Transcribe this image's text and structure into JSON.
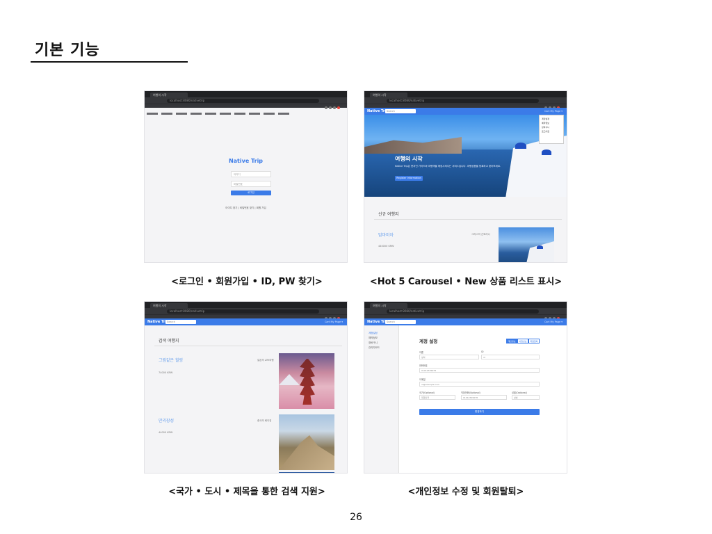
{
  "slide": {
    "title": "기본 기능",
    "page_number": "26"
  },
  "captions": {
    "login": "<로그인 • 회원가입 • ID, PW 찾기>",
    "carousel": "<Hot 5 Carousel • New 상품 리스트 표시>",
    "search": "<국가 • 도시 • 제목을 통한 검색 지원>",
    "settings": "<개인정보 수정 및 회원탈퇴>"
  },
  "login_shot": {
    "brand": "Native Trip",
    "id_placeholder": "아이디",
    "pw_placeholder": "비밀번호",
    "button": "로그인",
    "links": "아이디 찾기 | 비밀번호 찾기 | 회원 가입"
  },
  "carousel_shot": {
    "nav_brand": "Native Trip",
    "nav_search": "Search",
    "nav_right": "Cart   My Page ▾",
    "dropdown_items": [
      "계정설정",
      "예약정보",
      "장바구니",
      "로그아웃"
    ],
    "hero_title": "여행의 시작",
    "hero_text": "Native Trip은 현지인 가이드와 여행객을 매칭시켜주는 서비스입니다. 여행상품을 등록하고 찾아보세요.",
    "hero_button": "Register Information",
    "section_title": "신규 여행지",
    "item_title": "맘마미아",
    "item_region": "그리스의 산토리니",
    "item_price": "440000 KRW"
  },
  "search_shot": {
    "nav_brand": "Native Trip",
    "nav_search": "Search",
    "nav_right": "Cart   My Page ▾",
    "section_title": "검색 여행지",
    "items": [
      {
        "title": "그림같은 힐링",
        "region": "일본의 교토여행",
        "price": "74000 KRW"
      },
      {
        "title": "만리장성",
        "region": "중국의 베이징",
        "price": "44000 KRW"
      }
    ]
  },
  "settings_shot": {
    "nav_brand": "Native Trip",
    "nav_search": "Search",
    "nav_right": "Cart   My Page ▾",
    "sidebar_items": [
      "계정설정",
      "예약정보",
      "장바구니",
      "관리자모드"
    ],
    "title": "계정 설정",
    "segments": [
      "개인정보",
      "비밀번호",
      "회원탈퇴"
    ],
    "labels": {
      "name": "이름",
      "id": "ID",
      "phone": "전화번호",
      "email": "이메일",
      "country": "국가(Optional)",
      "contact": "직장전화(Optional)",
      "gender": "성별(Optional)"
    },
    "values": {
      "name": "성이",
      "id": "id",
      "phone": "01012345678",
      "email": "id@example.com",
      "country": "대한민국",
      "contact": "01012345678",
      "gender": "남성"
    },
    "submit": "변경하기"
  },
  "browser": {
    "tab_title": "여행의 시작",
    "url": "localhost:8080/nativetrip"
  }
}
